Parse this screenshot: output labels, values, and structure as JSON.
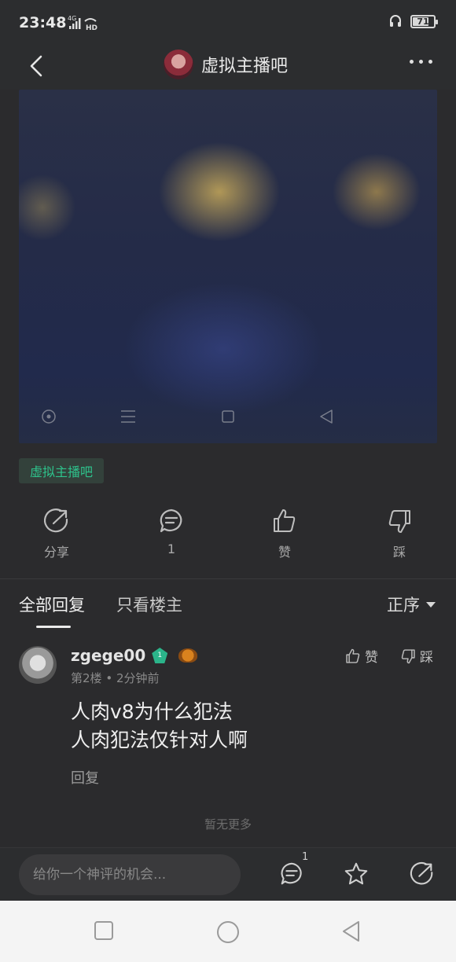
{
  "status_bar": {
    "time": "23:48",
    "network": "4G",
    "hd": "HD",
    "battery": "71"
  },
  "nav": {
    "forum_name": "虚拟主播吧"
  },
  "post": {
    "forum_tag": "虚拟主播吧"
  },
  "actions": {
    "share": "分享",
    "comment_count": "1",
    "like": "赞",
    "dislike": "踩"
  },
  "reply_tabs": {
    "all": "全部回复",
    "op_only": "只看楼主",
    "sort": "正序"
  },
  "comment": {
    "username": "zgege00",
    "level": "1",
    "floor": "第2楼",
    "time": "2分钟前",
    "line1": "人肉v8为什么犯法",
    "line2": "人肉犯法仅针对人啊",
    "reply": "回复",
    "like": "赞",
    "dislike": "踩"
  },
  "no_more": "暂无更多",
  "bottom": {
    "input_placeholder": "给你一个神评的机会...",
    "comment_count": "1"
  },
  "colors": {
    "accent_green": "#2ec38c",
    "background": "#2b2b2d"
  }
}
